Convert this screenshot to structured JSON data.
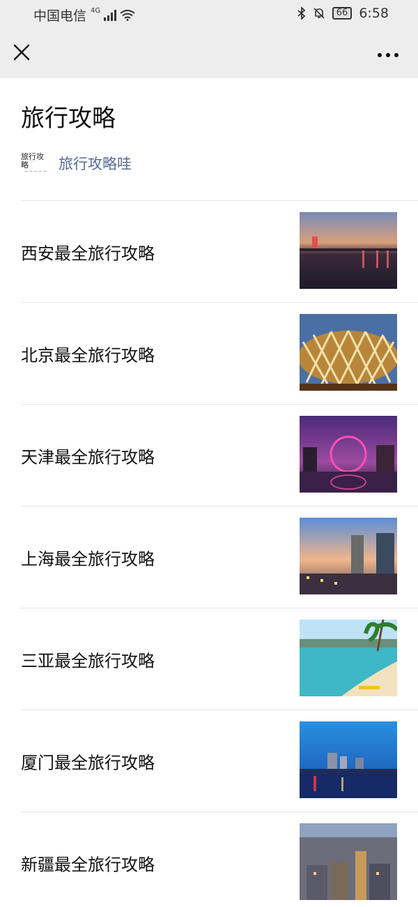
{
  "status_bar": {
    "carrier": "中国电信",
    "network": "4G",
    "battery": "66",
    "time": "6:58"
  },
  "nav": {
    "close_icon": "close-icon",
    "more_icon": "more-dots-icon"
  },
  "article": {
    "title": "旅行攻略",
    "account": {
      "avatar_text": "旅行攻略",
      "name": "旅行攻略哇"
    }
  },
  "items": [
    {
      "title": "西安最全旅行攻略",
      "image": "xian-night-tower-image"
    },
    {
      "title": "北京最全旅行攻略",
      "image": "birds-nest-stadium-image"
    },
    {
      "title": "天津最全旅行攻略",
      "image": "tianjin-ferris-wheel-image"
    },
    {
      "title": "上海最全旅行攻略",
      "image": "shanghai-skyline-image"
    },
    {
      "title": "三亚最全旅行攻略",
      "image": "sanya-beach-image"
    },
    {
      "title": "厦门最全旅行攻略",
      "image": "xiamen-night-skyline-image"
    },
    {
      "title": "新疆最全旅行攻略",
      "image": "xinjiang-city-image"
    }
  ],
  "colors": {
    "link": "#576b95",
    "bar": "#ededed",
    "divider": "#e5e5e5"
  }
}
